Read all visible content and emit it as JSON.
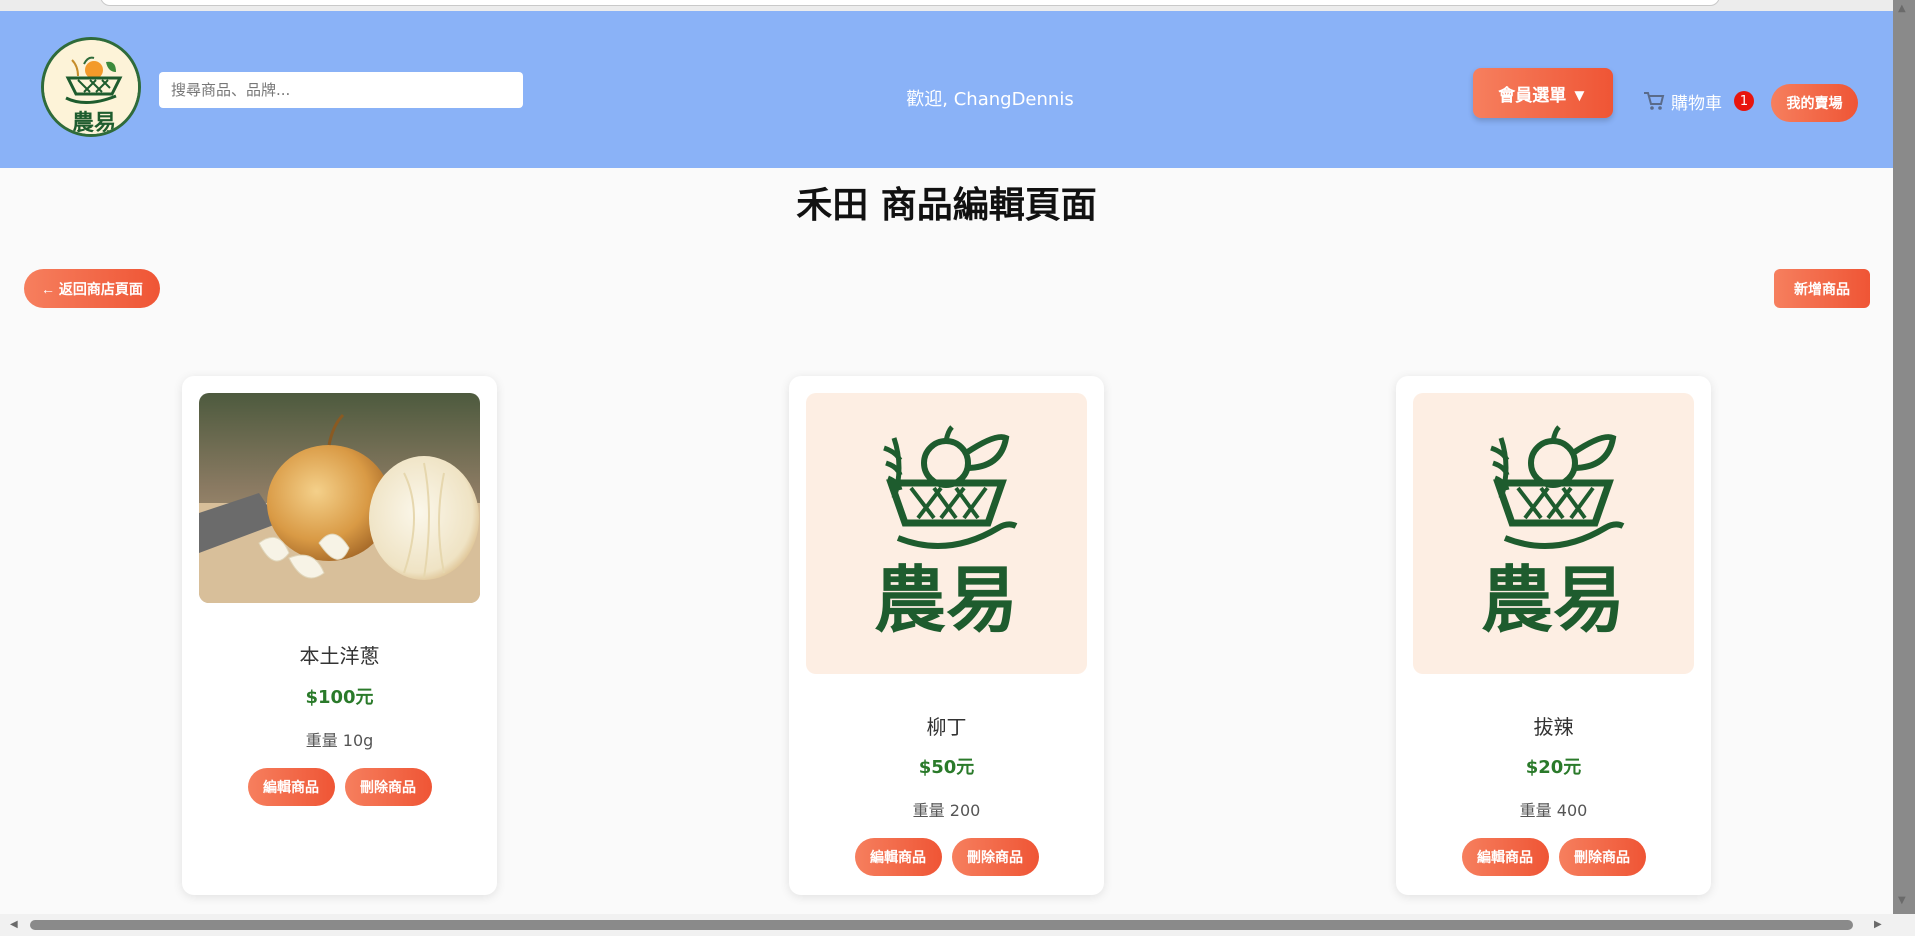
{
  "header": {
    "search_placeholder": "搜尋商品、品牌...",
    "welcome": "歡迎, ChangDennis",
    "member_menu_label": "會員選單 ▼",
    "cart_label": "購物車",
    "cart_count": "1",
    "my_farm_label": "我的賣場",
    "logo_text": "農易"
  },
  "page": {
    "title": "禾田 商品編輯頁面",
    "back_label": "← 返回商店頁面",
    "add_label": "新增商品"
  },
  "products": [
    {
      "name": "本土洋蔥",
      "price": "$100元",
      "weight": "重量 10g",
      "edit": "編輯商品",
      "delete": "刪除商品",
      "image": "onion-photo"
    },
    {
      "name": "柳丁",
      "price": "$50元",
      "weight": "重量 200",
      "edit": "編輯商品",
      "delete": "刪除商品",
      "image": "logo-placeholder"
    },
    {
      "name": "拔辣",
      "price": "$20元",
      "weight": "重量 400",
      "edit": "編輯商品",
      "delete": "刪除商品",
      "image": "logo-placeholder"
    }
  ],
  "colors": {
    "header_bg": "#8ab2f7",
    "accent_gradient_start": "#f67f5e",
    "accent_gradient_end": "#ef5535",
    "price_green": "#2a7a2a",
    "logo_green": "#1e5c2e",
    "placeholder_bg": "#fdeee3"
  }
}
